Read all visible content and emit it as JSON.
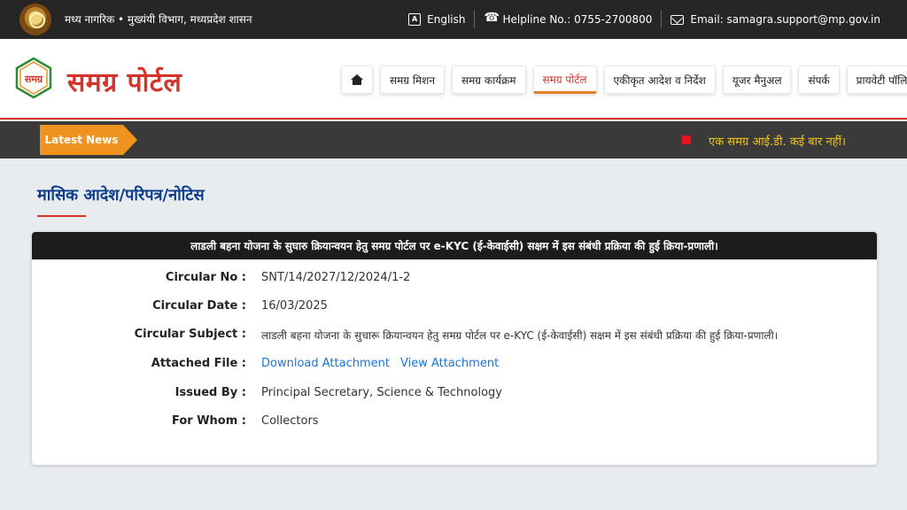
{
  "topbar": {
    "dept_text": "मध्य नागरिक • मुख्यंयी विभाग, मध्यप्रदेश शासन",
    "language": "English",
    "helpline": "Helpline No.: 0755-2700800",
    "email": "Email: samagra.support@mp.gov.in"
  },
  "header": {
    "logo_title": "समग्र पोर्टल",
    "logo_mark_text": "समग्र",
    "nav": [
      {
        "label": ""
      },
      {
        "label": "समग्र मिशन"
      },
      {
        "label": "समग्र कार्यक्रम"
      },
      {
        "label": "समग्र पोर्टल"
      },
      {
        "label": "एकीकृत आदेश व निर्देश"
      },
      {
        "label": "यूजर मैनुअल"
      },
      {
        "label": "संपर्क"
      },
      {
        "label": "प्रायवेटी पॉलिसी"
      }
    ]
  },
  "newsbar": {
    "label": "Latest News",
    "text": "एक समग्र आई.डी. कई बार नहीं।"
  },
  "page": {
    "title": "मासिक आदेश/परिपत्र/नोटिस"
  },
  "card": {
    "heading": "लाडली बहना योजना के सुघारु क्रियान्वयन हेतु समग्र पोर्टल पर e-KYC (ई-केवाईसी) सक्षम में इस संबंधी प्रक्रिया की हुई क्रिया-प्रणाली।",
    "rows": [
      {
        "label": "Circular No :",
        "value": "SNT/14/2027/12/2024/1-2"
      },
      {
        "label": "Circular Date :",
        "value": "16/03/2025"
      },
      {
        "label": "Circular Subject :",
        "value": "लाडली बहना योजना के सुचारू क्रियान्वयन हेतु समग्र पोर्टल पर e-KYC (ई-केवाईसी) सक्षम में इस संबंधी प्रक्रिया की हुई क्रिया-प्रणाली।"
      },
      {
        "label": "Attached File :",
        "value": ""
      },
      {
        "label": "Issued By :",
        "value": "Principal Secretary, Science & Technology"
      },
      {
        "label": "For Whom :",
        "value": "Collectors"
      }
    ],
    "attachment": {
      "download": "Download Attachment",
      "view": "View Attachment"
    }
  },
  "colors": {
    "accent_red": "#d4342c",
    "news_orange": "#f0921e",
    "title_blue": "#0d3c8c",
    "link_blue": "#1a73d9"
  }
}
